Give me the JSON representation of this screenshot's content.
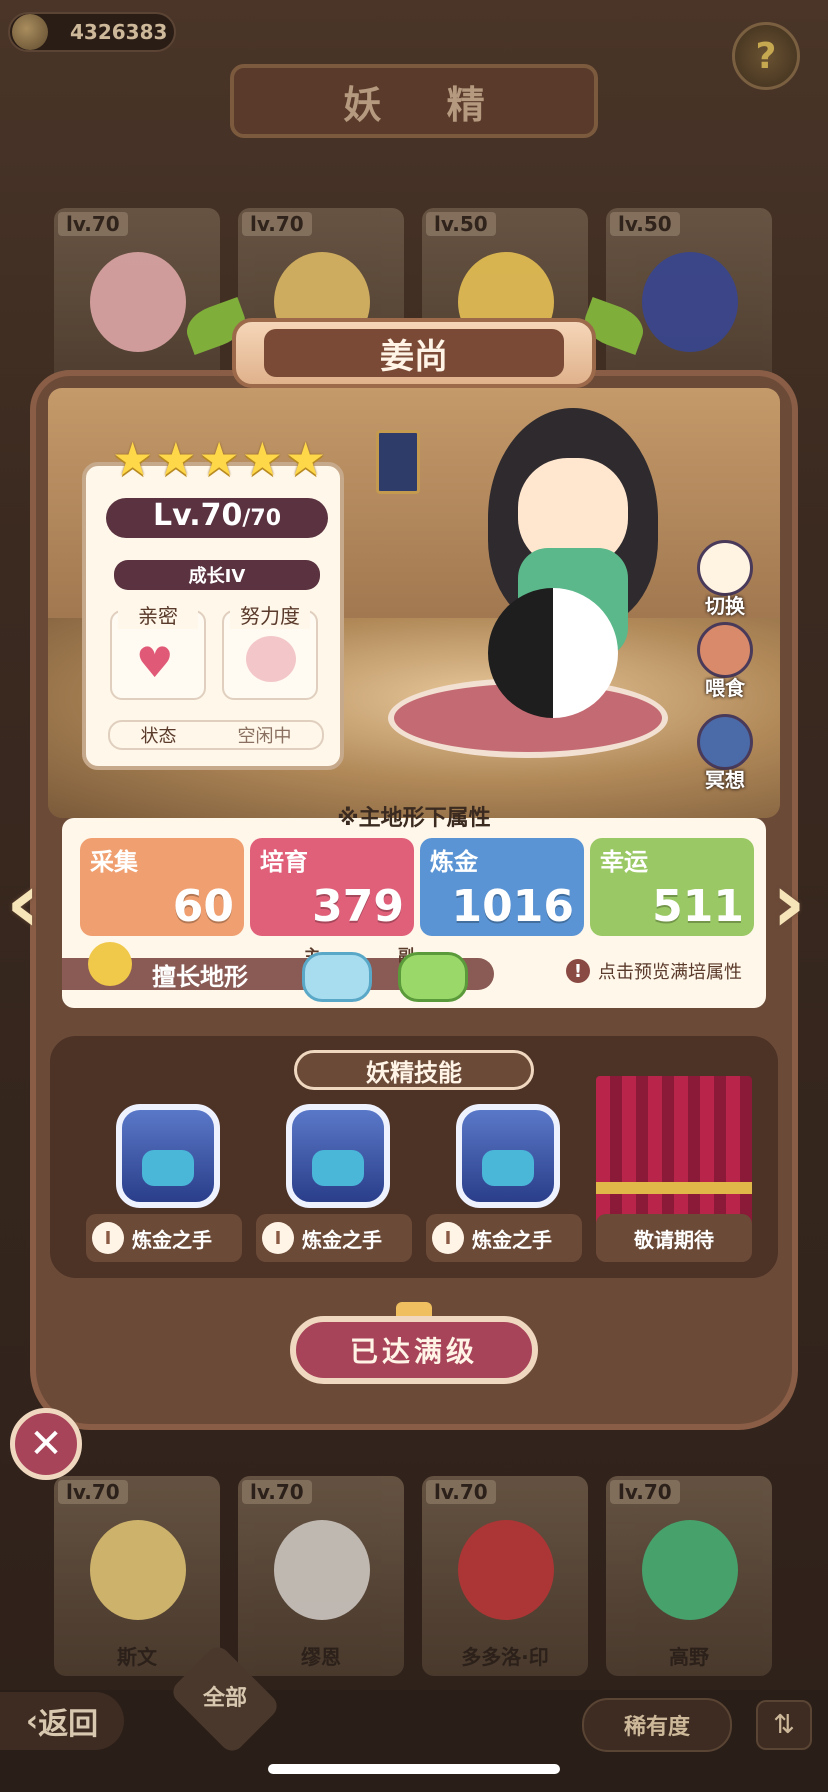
{
  "header": {
    "currency_value": "4326383",
    "title": "妖 精",
    "help_icon": "question-mark"
  },
  "bg_cards_top": [
    {
      "level": "lv.70"
    },
    {
      "level": "lv.70"
    },
    {
      "level": "lv.50"
    },
    {
      "level": "lv.50"
    }
  ],
  "bg_cards_bottom": [
    {
      "level": "lv.70",
      "name": "斯文"
    },
    {
      "level": "lv.70",
      "name": "缪恩"
    },
    {
      "level": "lv.70",
      "name": "多多洛·印"
    },
    {
      "level": "lv.70",
      "name": "高野"
    }
  ],
  "fairy": {
    "name": "姜尚",
    "stars": 5,
    "level": "Lv.70",
    "level_max": "/70",
    "growth": "成长IV",
    "intimacy_label": "亲密",
    "effort_label": "努力度",
    "status_label": "状态",
    "status_value": "空闲中"
  },
  "actions": {
    "switch": "切换",
    "feed": "喂食",
    "meditate": "冥想"
  },
  "attributes": {
    "note": "※主地形下属性",
    "items": [
      {
        "name": "采集",
        "value": "60",
        "color": "#f0a070"
      },
      {
        "name": "培育",
        "value": "379",
        "color": "#e0607a"
      },
      {
        "name": "炼金",
        "value": "1016",
        "color": "#5a94d4"
      },
      {
        "name": "幸运",
        "value": "511",
        "color": "#9ac864"
      }
    ],
    "terrain_label": "擅长地形",
    "terrain_main": "主",
    "terrain_sub": "副",
    "preview": "点击预览满培属性"
  },
  "skills": {
    "title": "妖精技能",
    "items": [
      {
        "level": "I",
        "name": "炼金之手"
      },
      {
        "level": "I",
        "name": "炼金之手"
      },
      {
        "level": "I",
        "name": "炼金之手"
      },
      {
        "level": "",
        "name": "敬请期待"
      }
    ]
  },
  "max_button": "已达满级",
  "bottom": {
    "back": "返回",
    "filter_all": "全部",
    "rarity": "稀有度"
  }
}
